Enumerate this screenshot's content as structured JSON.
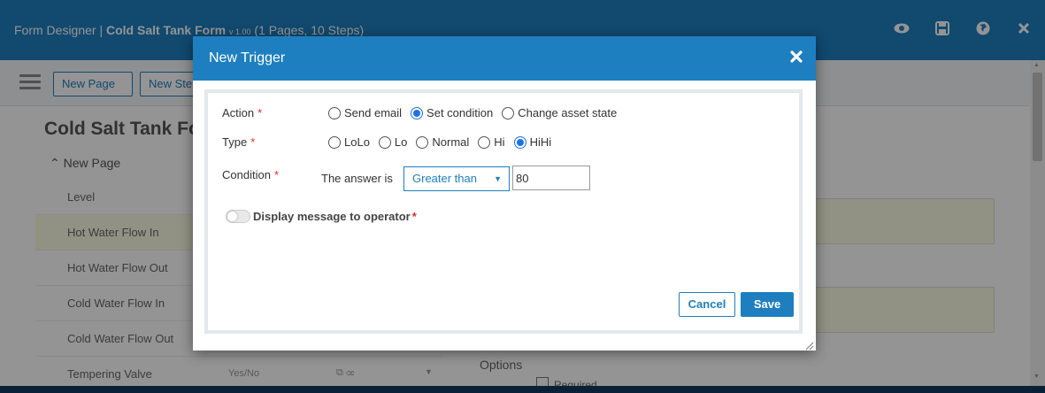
{
  "app": {
    "title_prefix": "Form Designer | ",
    "form_name": "Cold Salt Tank Form",
    "version": "v 1.00",
    "meta": "(1 Pages, 10 Steps)",
    "icons": [
      "eye-icon",
      "save-icon",
      "globe-icon",
      "close-icon"
    ]
  },
  "toolbar": {
    "new_page": "New Page",
    "new_step": "New Step"
  },
  "left": {
    "heading": "Cold Salt Tank Form",
    "section": "New Page",
    "steps": [
      {
        "label": "Level"
      },
      {
        "label": "Hot Water Flow In"
      },
      {
        "label": "Hot Water Flow Out"
      },
      {
        "label": "Cold Water Flow In"
      },
      {
        "label": "Cold Water Flow Out"
      },
      {
        "label": "Tempering Valve",
        "type": "Yes/No"
      }
    ]
  },
  "right": {
    "options_label": "Options",
    "required_label": "Required"
  },
  "modal": {
    "title": "New Trigger",
    "action": {
      "label": "Action",
      "options": [
        "Send email",
        "Set condition",
        "Change asset state"
      ],
      "selected": "Set condition"
    },
    "type": {
      "label": "Type",
      "options": [
        "LoLo",
        "Lo",
        "Normal",
        "Hi",
        "HiHi"
      ],
      "selected": "HiHi"
    },
    "condition": {
      "label": "Condition",
      "prefix": "The answer is",
      "operator": "Greater than",
      "value": "80"
    },
    "display_message": {
      "label": "Display message to operator",
      "enabled": false
    },
    "buttons": {
      "cancel": "Cancel",
      "save": "Save"
    }
  },
  "colors": {
    "brand": "#1e7fc0",
    "required": "#d9302c",
    "radio_checked": "#1a73e8"
  }
}
